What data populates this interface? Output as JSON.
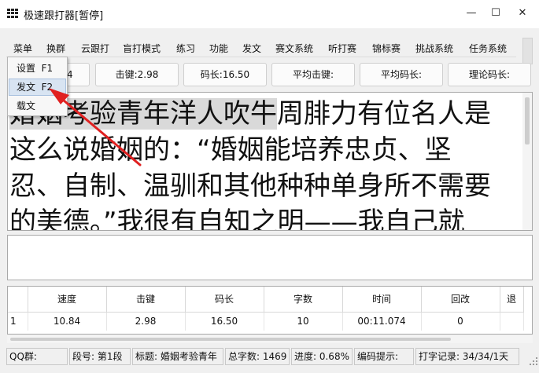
{
  "window": {
    "title": "极速跟打器[暂停]",
    "minimize": "—",
    "maximize": "☐",
    "close": "✕"
  },
  "menu": [
    "菜单",
    "换群",
    "云跟打",
    "盲打模式",
    "练习",
    "功能",
    "发文",
    "赛文系统",
    "听打赛",
    "锦标赛",
    "挑战系统",
    "任务系统"
  ],
  "dropdown": {
    "items": [
      {
        "label": "设置",
        "shortcut": "F1"
      },
      {
        "label": "发文",
        "shortcut": "F2"
      },
      {
        "label": "载文",
        "shortcut": ""
      }
    ],
    "active_index": 1
  },
  "stats": {
    "speed_partial": "4",
    "keystroke": "击键:2.98",
    "code_length": "码长:16.50",
    "avg_keystroke": "平均击键:",
    "avg_code_length": "平均码长:",
    "theory_code_length": "理论码长:"
  },
  "text_display": {
    "highlighted": "婚姻考验青年洋人吹牛",
    "lines": [
      "周腓力有位名人是",
      "这么说婚姻的：“婚姻能培养忠贞、坚",
      "忍、自制、温驯和其他种种单身所不需要",
      "的美德。”我很有自知之明——我自己就"
    ]
  },
  "typing_input": {
    "value": ""
  },
  "table": {
    "columns": [
      "",
      "速度",
      "击键",
      "码长",
      "字数",
      "时间",
      "回改",
      "退"
    ],
    "rows": [
      [
        "1",
        "10.84",
        "2.98",
        "16.50",
        "10",
        "00:11.074",
        "0",
        ""
      ]
    ]
  },
  "status": {
    "qq_group": "QQ群:",
    "segment": "段号: 第1段",
    "title": "标题: 婚姻考验青年",
    "total_chars": "总字数: 1469",
    "progress": "进度: 0.68%",
    "coding_hint": "编码提示:",
    "typing_record": "打字记录: 34/34/1天"
  },
  "colors": {
    "highlight": "#d9d9d9",
    "arrow": "#e02020",
    "active_menu": "#d8e4f2"
  }
}
